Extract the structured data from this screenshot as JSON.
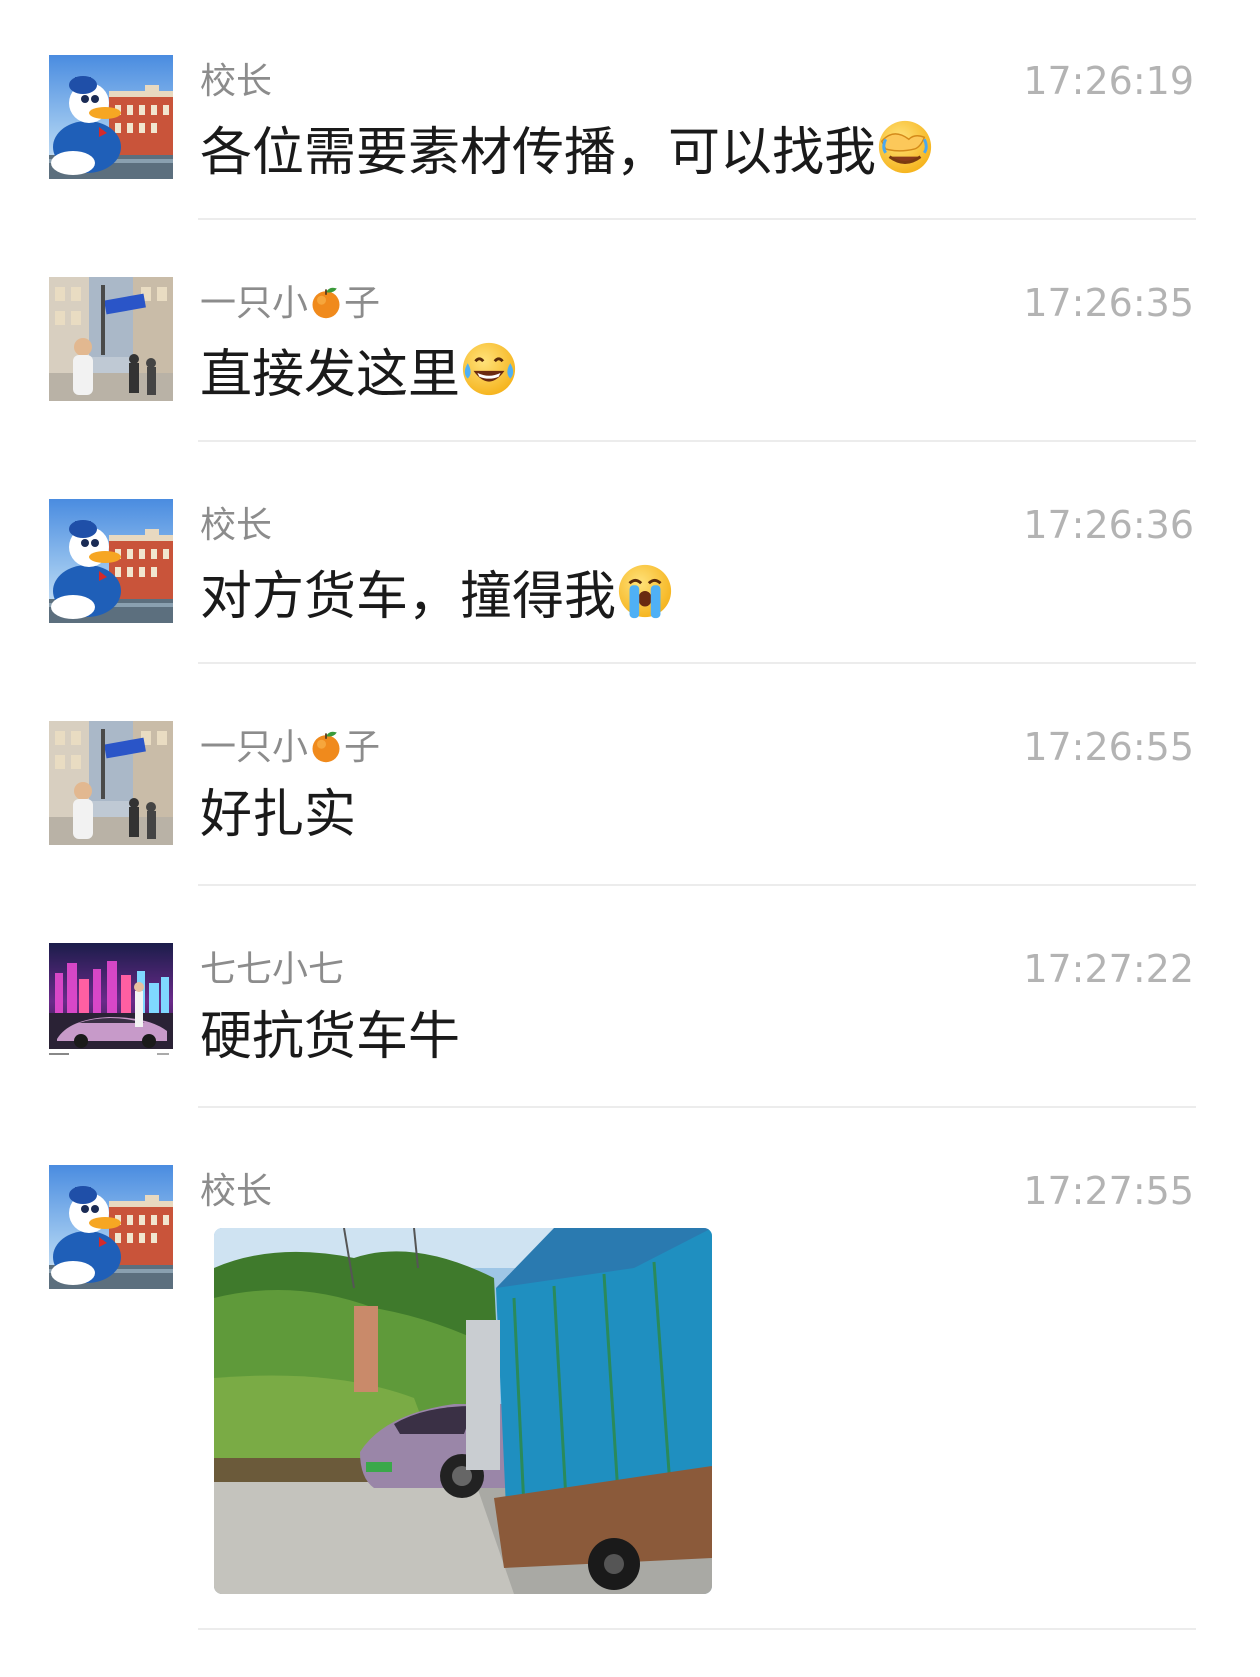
{
  "messages": [
    {
      "sender": "校长",
      "time": "17:26:19",
      "text": "各位需要素材传播，可以找我",
      "emoji": "face-with-hand-over-eyes-emoji"
    },
    {
      "sender_prefix": "一只小",
      "sender_suffix": "子",
      "time": "17:26:35",
      "text": "直接发这里",
      "emoji": "tears-of-joy-emoji"
    },
    {
      "sender": "校长",
      "time": "17:26:36",
      "text": "对方货车，撞得我",
      "emoji": "loudly-crying-emoji"
    },
    {
      "sender_prefix": "一只小",
      "sender_suffix": "子",
      "time": "17:26:55",
      "text": "好扎实"
    },
    {
      "sender": "七七小七",
      "time": "17:27:22",
      "text": "硬抗货车牛"
    },
    {
      "sender": "校长",
      "time": "17:27:55",
      "image": "truck-collision-photo"
    }
  ],
  "icons": {
    "orange": "orange-emoji"
  },
  "colors": {
    "name": "#8c8c8c",
    "time": "#b3b3b3",
    "text": "#1a1a1a",
    "divider": "#ececec"
  }
}
